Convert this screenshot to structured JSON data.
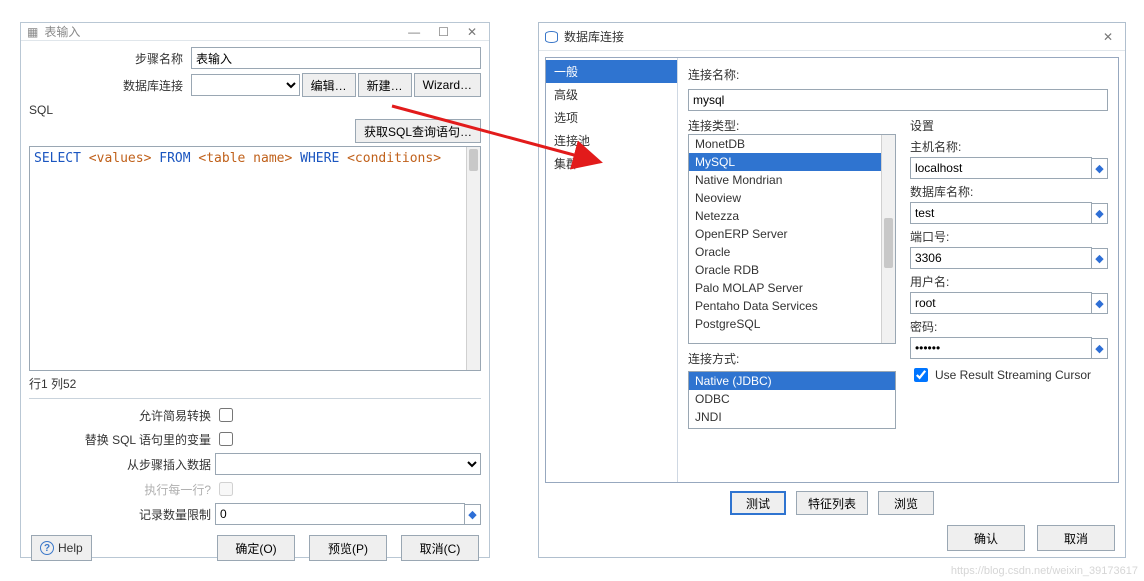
{
  "win1": {
    "title": "表输入",
    "step_name_label": "步骤名称",
    "step_name_value": "表输入",
    "db_conn_label": "数据库连接",
    "db_conn_value": "",
    "btn_edit": "编辑…",
    "btn_new": "新建…",
    "btn_wizard": "Wizard…",
    "sql_label": "SQL",
    "btn_get_sql": "获取SQL查询语句…",
    "sql_kw_select": "SELECT",
    "sql_ph_values": "<values>",
    "sql_kw_from": "FROM",
    "sql_ph_table": "<table name>",
    "sql_kw_where": "WHERE",
    "sql_ph_cond": "<conditions>",
    "status": "行1 列52",
    "chk_simple_conv": "允许简易转换",
    "chk_replace_vars": "替换 SQL 语句里的变量",
    "from_step_label": "从步骤插入数据",
    "each_row_label": "执行每一行?",
    "limit_label": "记录数量限制",
    "limit_value": "0",
    "btn_help": "Help",
    "btn_ok": "确定(O)",
    "btn_preview": "预览(P)",
    "btn_cancel": "取消(C)"
  },
  "win2": {
    "title": "数据库连接",
    "nav": [
      "一般",
      "高级",
      "选项",
      "连接池",
      "集群"
    ],
    "conn_name_label": "连接名称:",
    "conn_name_value": "mysql",
    "conn_type_label": "连接类型:",
    "types": [
      "MonetDB",
      "MySQL",
      "Native Mondrian",
      "Neoview",
      "Netezza",
      "OpenERP Server",
      "Oracle",
      "Oracle RDB",
      "Palo MOLAP Server",
      "Pentaho Data Services",
      "PostgreSQL"
    ],
    "types_selected_index": 1,
    "access_label": "连接方式:",
    "access": [
      "Native (JDBC)",
      "ODBC",
      "JNDI"
    ],
    "access_selected_index": 0,
    "settings_label": "设置",
    "host_label": "主机名称:",
    "host_value": "localhost",
    "dbname_label": "数据库名称:",
    "dbname_value": "test",
    "port_label": "端口号:",
    "port_value": "3306",
    "user_label": "用户名:",
    "user_value": "root",
    "pass_label": "密码:",
    "pass_value": "••••••",
    "chk_cursor": "Use Result Streaming Cursor",
    "btn_test": "测试",
    "btn_feature": "特征列表",
    "btn_browse": "浏览",
    "btn_ok": "确认",
    "btn_cancel": "取消"
  },
  "watermark": "https://blog.csdn.net/weixin_39173617"
}
